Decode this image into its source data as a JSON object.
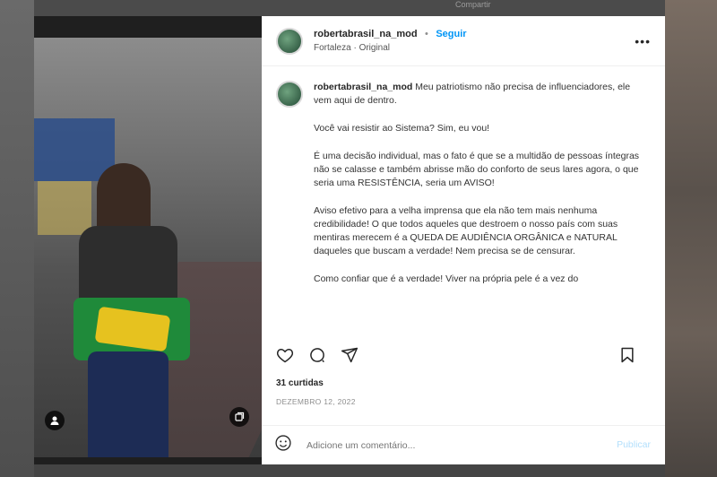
{
  "background": {
    "top_text": "Compartir"
  },
  "post": {
    "username": "robertabrasil_na_mod",
    "follow_label": "Seguir",
    "location": "Fortaleza · Original",
    "more_label": "•••",
    "caption": {
      "username": "robertabrasil_na_mod",
      "paragraphs": [
        "Meu patriotismo não precisa de influenciadores, ele vem aqui de dentro.",
        "Você vai resistir ao Sistema? Sim, eu vou!",
        "É uma decisão individual, mas o fato é que se a multidão de pessoas íntegras não se calasse e também abrisse mão do conforto de seus lares agora, o que seria uma RESISTÊNCIA, seria um AVISO!",
        "Aviso efetivo para a velha imprensa que ela não tem mais nenhuma credibilidade! O que todos aqueles que destroem o nosso país com suas mentiras merecem é a QUEDA DE AUDIÊNCIA ORGÂNICA e NATURAL daqueles que buscam a verdade! Nem precisa se de censurar.",
        "Como confiar que é a verdade! Viver na própria pele é a vez do"
      ]
    },
    "likes": "31 curtidas",
    "date": "DEZEMBRO 12, 2022",
    "comment_placeholder": "Adicione um comentário...",
    "publish_label": "Publicar"
  },
  "icons": {
    "heart": "heart-icon",
    "comment": "comment-icon",
    "share": "share-icon",
    "save": "bookmark-icon",
    "emoji": "emoji-icon",
    "user_tag": "user-tag-icon",
    "collection": "collection-icon"
  },
  "colors": {
    "accent": "#0095f6",
    "publish_disabled": "#b2dffc",
    "text": "#262626",
    "muted": "#8e8e8e"
  }
}
